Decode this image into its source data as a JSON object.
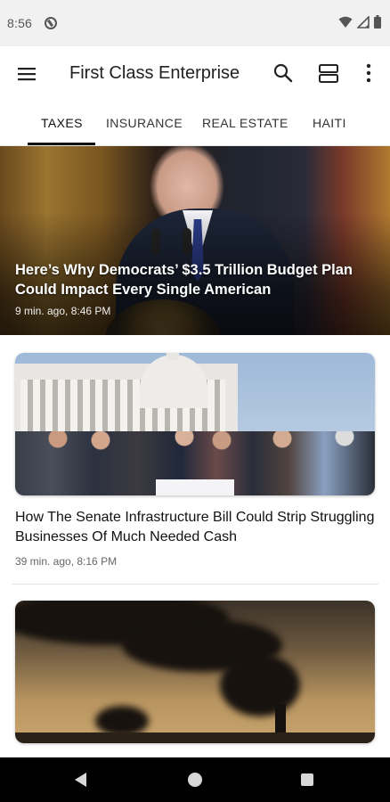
{
  "status_bar": {
    "time": "8:56",
    "icons": [
      "app-notification-icon",
      "wifi-icon",
      "signal-icon",
      "battery-icon"
    ]
  },
  "app_bar": {
    "title": "First Class Enterprise",
    "icons": [
      "menu-icon",
      "search-icon",
      "layout-toggle-icon",
      "more-vert-icon"
    ]
  },
  "tabs": [
    {
      "label": "TAXES",
      "active": true
    },
    {
      "label": "INSURANCE",
      "active": false
    },
    {
      "label": "REAL ESTATE",
      "active": false
    },
    {
      "label": "HAITI",
      "active": false
    }
  ],
  "hero": {
    "title": "Here’s Why Democrats’ $3.5 Trillion Budget Plan Could Impact Every Single American",
    "meta": "9 min. ago, 8:46 PM"
  },
  "articles": [
    {
      "title": "How The Senate Infrastructure Bill Could Strip Struggling Businesses Of Much Needed Cash",
      "meta": "39 min. ago, 8:16 PM"
    }
  ],
  "nav_bar": {
    "icons": [
      "back-icon",
      "home-icon",
      "recents-icon"
    ]
  },
  "colors": {
    "tab_indicator": "#111111",
    "nav_bar": "#000000",
    "status_bar": "#f1f1f1"
  }
}
